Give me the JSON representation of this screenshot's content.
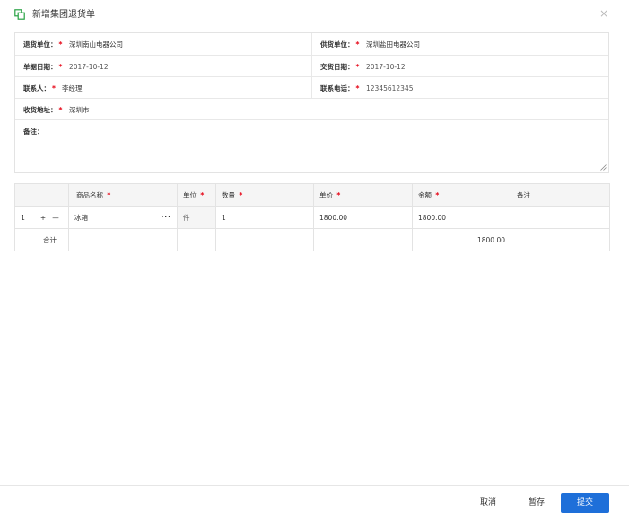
{
  "dialog": {
    "title": "新增集团退货单",
    "close_symbol": "×",
    "colors": {
      "icon": "#27a243",
      "primary": "#1e6fd9",
      "required": "#e60012"
    }
  },
  "form": {
    "required_mark": "*",
    "return_unit": {
      "label": "退货单位：",
      "value": "深圳南山电器公司"
    },
    "supply_unit": {
      "label": "供货单位：",
      "value": "深圳盐田电器公司"
    },
    "doc_date": {
      "label": "单据日期：",
      "value": "2017-10-12"
    },
    "delivery_date": {
      "label": "交货日期：",
      "value": "2017-10-12"
    },
    "contact": {
      "label": "联系人：",
      "value": "李经理"
    },
    "phone": {
      "label": "联系电话：",
      "value": "12345612345"
    },
    "address": {
      "label": "收货地址：",
      "value": "深圳市"
    },
    "remark": {
      "label": "备注：",
      "value": ""
    }
  },
  "grid": {
    "headers": {
      "product": "商品名称",
      "unit": "单位",
      "qty": "数量",
      "price": "单价",
      "amount": "金额",
      "note": "备注"
    },
    "rows": [
      {
        "index": "1",
        "add": "+",
        "remove": "—",
        "product": "冰箱",
        "more": "···",
        "unit": "件",
        "qty": "1",
        "price": "1800.00",
        "amount": "1800.00",
        "note": ""
      }
    ],
    "total": {
      "label": "合计",
      "amount": "1800.00"
    }
  },
  "footer": {
    "cancel": "取消",
    "save_draft": "暂存",
    "submit": "提交"
  }
}
